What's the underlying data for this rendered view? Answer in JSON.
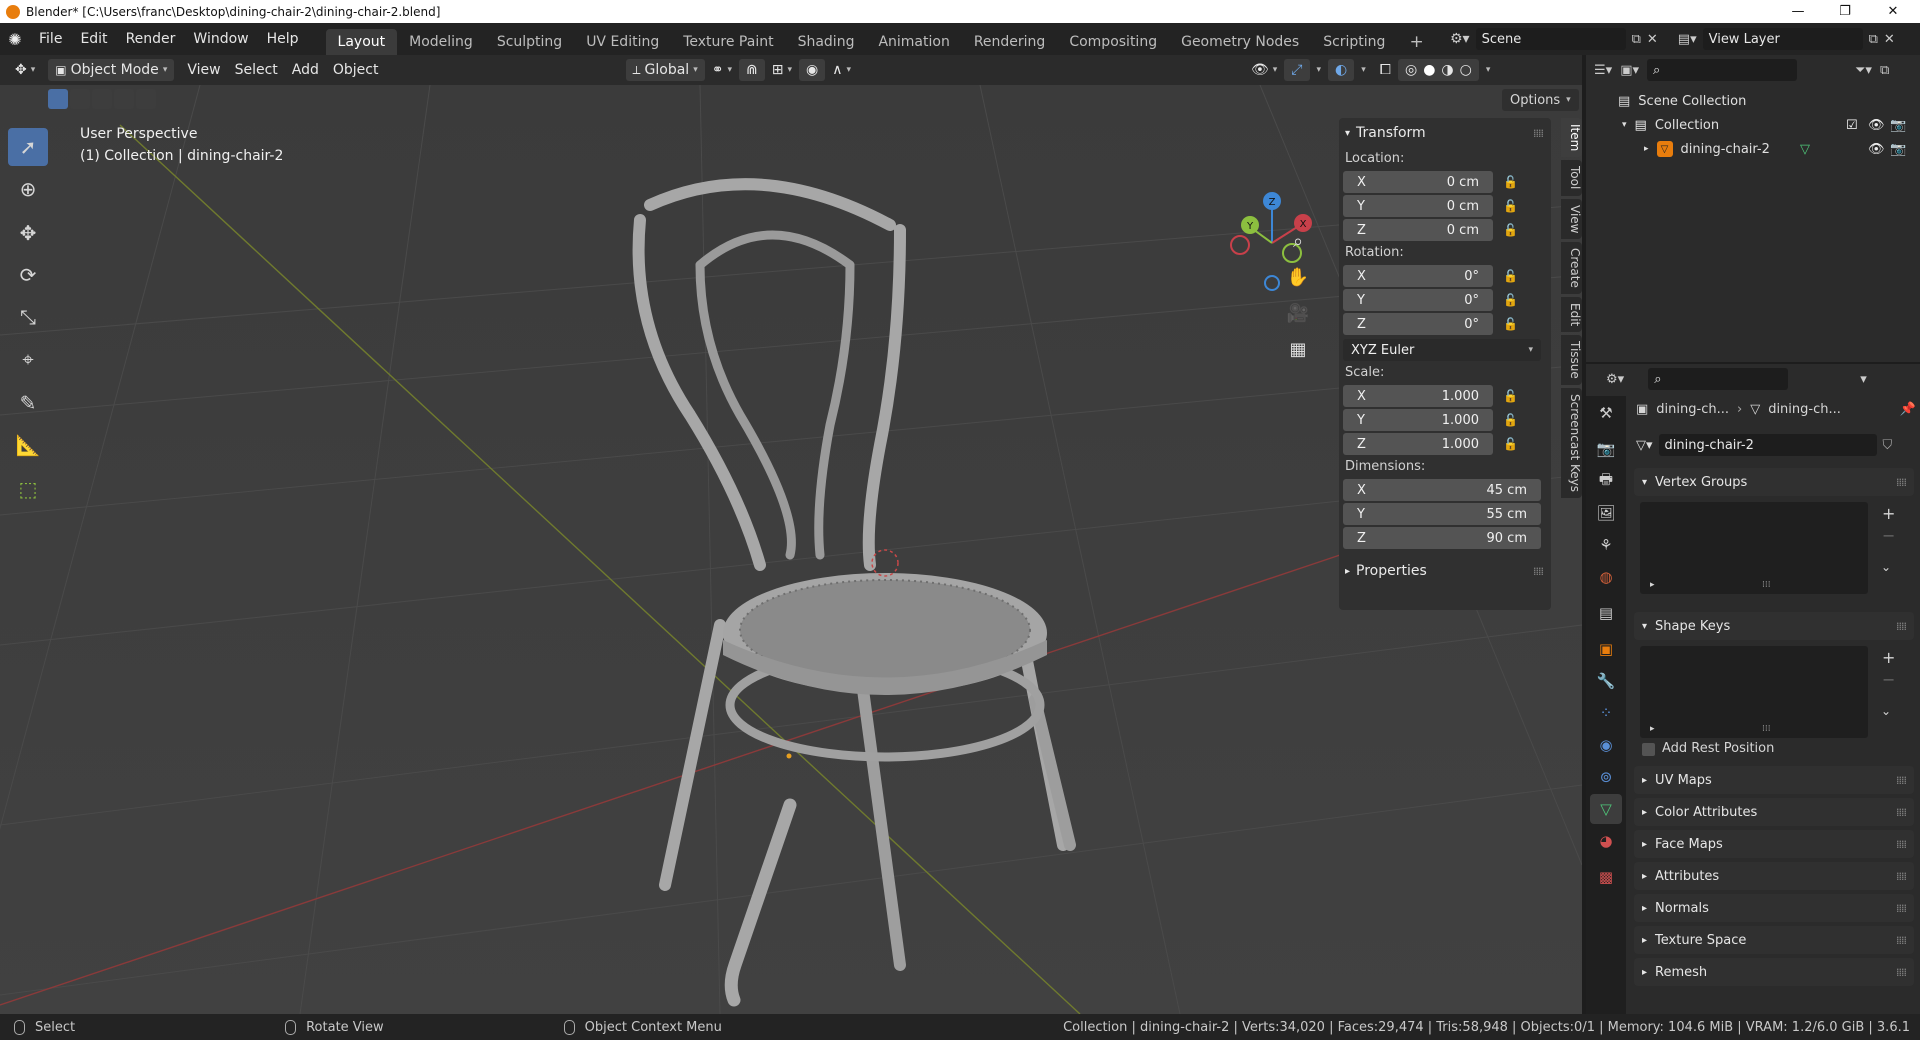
{
  "titlebar": {
    "text": "Blender* [C:\\Users\\franc\\Desktop\\dining-chair-2\\dining-chair-2.blend]",
    "min": "—",
    "max": "❐",
    "close": "✕"
  },
  "menus": [
    "File",
    "Edit",
    "Render",
    "Window",
    "Help"
  ],
  "workspaces": [
    "Layout",
    "Modeling",
    "Sculpting",
    "UV Editing",
    "Texture Paint",
    "Shading",
    "Animation",
    "Rendering",
    "Compositing",
    "Geometry Nodes",
    "Scripting"
  ],
  "active_workspace": "Layout",
  "add_workspace": "+",
  "scene": {
    "label": "Scene",
    "view_layer": "View Layer"
  },
  "viewport_header": {
    "mode": "Object Mode",
    "menus": [
      "View",
      "Select",
      "Add",
      "Object"
    ],
    "orientation": "Global",
    "options": "Options"
  },
  "viewport": {
    "perspective": "User Perspective",
    "collection_line": "(1) Collection | dining-chair-2"
  },
  "gizmo": {
    "x": "X",
    "y": "Y",
    "z": "Z"
  },
  "transform": {
    "title": "Transform",
    "location_label": "Location:",
    "location": [
      {
        "axis": "X",
        "value": "0 cm"
      },
      {
        "axis": "Y",
        "value": "0 cm"
      },
      {
        "axis": "Z",
        "value": "0 cm"
      }
    ],
    "rotation_label": "Rotation:",
    "rotation": [
      {
        "axis": "X",
        "value": "0°"
      },
      {
        "axis": "Y",
        "value": "0°"
      },
      {
        "axis": "Z",
        "value": "0°"
      }
    ],
    "rotation_mode": "XYZ Euler",
    "scale_label": "Scale:",
    "scale": [
      {
        "axis": "X",
        "value": "1.000"
      },
      {
        "axis": "Y",
        "value": "1.000"
      },
      {
        "axis": "Z",
        "value": "1.000"
      }
    ],
    "dimensions_label": "Dimensions:",
    "dimensions": [
      {
        "axis": "X",
        "value": "45 cm"
      },
      {
        "axis": "Y",
        "value": "55 cm"
      },
      {
        "axis": "Z",
        "value": "90 cm"
      }
    ],
    "properties": "Properties"
  },
  "side_tabs": [
    "Item",
    "Tool",
    "View",
    "Create",
    "Edit",
    "Tissue",
    "Screencast Keys"
  ],
  "outliner": {
    "scene_collection": "Scene Collection",
    "collection": "Collection",
    "object": "dining-chair-2"
  },
  "properties": {
    "breadcrumb_object": "dining-ch...",
    "breadcrumb_data": "dining-ch...",
    "data_name": "dining-chair-2",
    "sections": {
      "vertex_groups": "Vertex Groups",
      "shape_keys": "Shape Keys",
      "add_rest_position": "Add Rest Position",
      "uv_maps": "UV Maps",
      "color_attributes": "Color Attributes",
      "face_maps": "Face Maps",
      "attributes": "Attributes",
      "normals": "Normals",
      "texture_space": "Texture Space",
      "remesh": "Remesh"
    }
  },
  "statusbar": {
    "select": "Select",
    "rotate": "Rotate View",
    "context": "Object Context Menu",
    "stats": "Collection | dining-chair-2 | Verts:34,020 | Faces:29,474 | Tris:58,948 | Objects:0/1 | Memory: 104.6 MiB | VRAM: 1.2/6.0 GiB | 3.6.1"
  },
  "colors": {
    "accent": "#4a6fa5",
    "x_axis": "#c8404a",
    "y_axis": "#8cbf3f",
    "z_axis": "#3d87d6",
    "object_orange": "#e87d0d",
    "mesh_green": "#4fc87a"
  }
}
